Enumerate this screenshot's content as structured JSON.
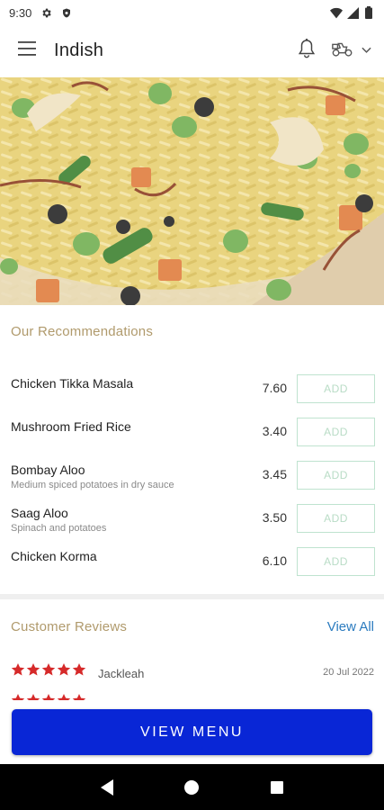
{
  "status_bar": {
    "time": "9:30",
    "icons": [
      "gear-icon",
      "shield-icon",
      "wifi-icon",
      "signal-icon",
      "battery-icon"
    ]
  },
  "app_bar": {
    "title": "Indish",
    "icons": [
      "menu-icon",
      "bell-icon",
      "delivery-scooter-icon",
      "chevron-down-icon"
    ]
  },
  "hero": {
    "image": "vegetable-pilau-rice-photo"
  },
  "recommendations": {
    "title": "Our Recommendations",
    "add_label": "ADD",
    "items": [
      {
        "name": "Chicken Tikka Masala",
        "description": "",
        "price": "7.60"
      },
      {
        "name": "Mushroom Fried Rice",
        "description": "",
        "price": "3.40"
      },
      {
        "name": "Bombay Aloo",
        "description": "Medium spiced potatoes in dry sauce",
        "price": "3.45"
      },
      {
        "name": "Saag Aloo",
        "description": "Spinach and potatoes",
        "price": "3.50"
      },
      {
        "name": "Chicken Korma",
        "description": "",
        "price": "6.10"
      }
    ]
  },
  "reviews": {
    "title": "Customer Reviews",
    "view_all": "View All",
    "items": [
      {
        "rating": 5,
        "reviewer": "Jackleah",
        "date": "20 Jul 2022"
      }
    ]
  },
  "view_menu": {
    "label": "VIEW MENU"
  },
  "nav_bar": {
    "icons": [
      "back-icon",
      "home-icon",
      "recents-icon"
    ]
  },
  "colors": {
    "accent_blue": "#0926d6",
    "section_title": "#b09a6c",
    "link": "#2b7bbf",
    "star": "#d62a2a",
    "add_border": "#bfe3cf"
  }
}
